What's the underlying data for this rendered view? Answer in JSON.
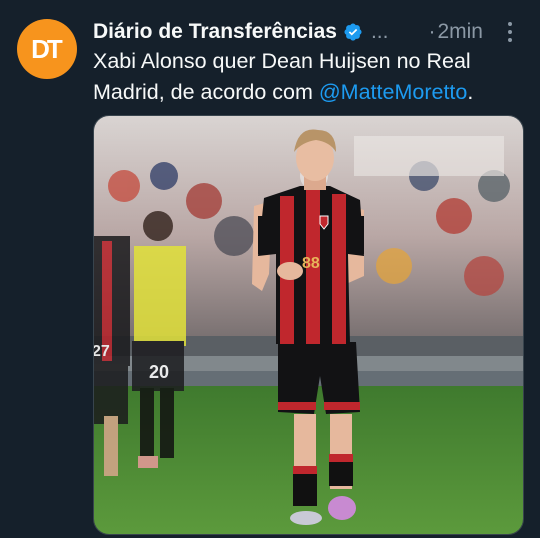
{
  "tweet": {
    "avatar_initials": "DT",
    "display_name": "Diário de Transferências",
    "handle_truncated": "...",
    "separator": "·",
    "timestamp": "2min",
    "text_before": "Xabi Alonso quer Dean Huijsen no Real Madrid, de acordo com ",
    "mention": "@MatteMoretto",
    "text_after": ".",
    "colors": {
      "background": "#15202b",
      "avatar": "#f7941d",
      "mention": "#1d9bf0",
      "muted": "#8b98a5"
    },
    "media": {
      "shirt_number": "88",
      "other_player_number": "20",
      "left_player_number": "27"
    }
  }
}
